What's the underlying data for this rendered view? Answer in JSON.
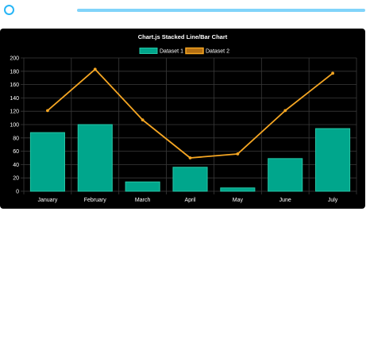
{
  "colors": {
    "ring": "#29b6f6",
    "top_bar": "#81d4fa",
    "card_background": "#000000",
    "grid": "#3a3a3a",
    "text": "#ffffff",
    "bar_fill": "#00a68c",
    "bar_border": "#26c6a6",
    "line": "#f5a623"
  },
  "chart_data": {
    "type": "bar",
    "title": "Chart.js Stacked Line/Bar Chart",
    "categories": [
      "January",
      "February",
      "March",
      "April",
      "May",
      "June",
      "July"
    ],
    "series": [
      {
        "name": "Dataset 1",
        "type": "bar",
        "values": [
          88,
          100,
          14,
          36,
          5,
          49,
          94
        ]
      },
      {
        "name": "Dataset 2",
        "type": "line",
        "values": [
          121,
          183,
          107,
          50,
          56,
          121,
          177
        ]
      }
    ],
    "ylim": [
      0,
      200
    ],
    "yticks": [
      0,
      20,
      40,
      60,
      80,
      100,
      120,
      140,
      160,
      180,
      200
    ],
    "grid": true,
    "legend": "top-center"
  }
}
